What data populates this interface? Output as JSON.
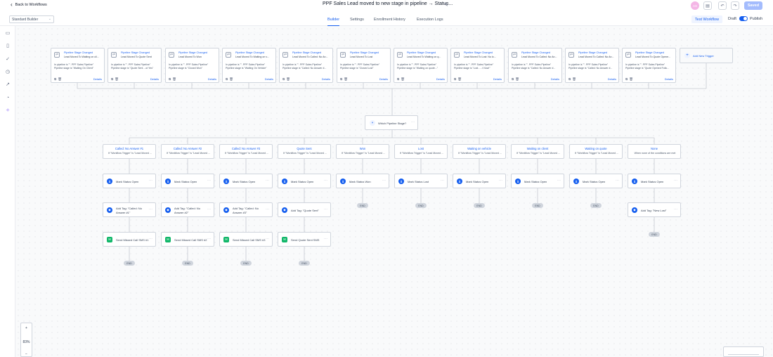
{
  "header": {
    "back_label": "Back to Workflows",
    "title": "PPF Sales Lead moved to new stage in pipeline → Status...",
    "avatar_initials": "AS",
    "save_label": "Saved"
  },
  "subbar": {
    "builder_select": "Standard Builder",
    "tabs": [
      "Builder",
      "Settings",
      "Enrollment History",
      "Execution Logs"
    ],
    "active_tab": "Builder",
    "test_workflow": "Test Workflow",
    "draft_label": "Draft",
    "publish_label": "Publish"
  },
  "triggers": [
    {
      "title": "Pipeline Stage Changed",
      "subtitle": "Lead Moved To Waiting on cli...",
      "desc1": "In pipeline is \"\". PPF Sales Pipeline\"",
      "desc2": "Pipeline stage is \"Waiting On Client\"",
      "details": "Details"
    },
    {
      "title": "Pipeline Stage Changed",
      "subtitle": "Lead Moved To Quote Sent",
      "desc1": "In pipeline is \"\". PPF Sales Pipeline\"",
      "desc2": "Pipeline stage is \"Quote Sent ...ot Yes\"",
      "details": "Details"
    },
    {
      "title": "Pipeline Stage Changed",
      "subtitle": "Lead Moved To Won",
      "desc1": "In pipeline is \"\". PPF Sales Pipeline\"",
      "desc2": "Pipeline stage is \"Closed Won\"",
      "details": "Details"
    },
    {
      "title": "Pipeline Stage Changed",
      "subtitle": "Lead Moved To Waiting on v...",
      "desc1": "In pipeline is \"\". PPF Sales Pipeline\"",
      "desc2": "Pipeline stage is \"Waiting On Vehicle\"",
      "details": "Details"
    },
    {
      "title": "Pipeline Stage Changed",
      "subtitle": "Lead Moved To Called: No An...",
      "desc1": "In pipeline is \"\". PPF Sales Pipeline\"",
      "desc2": "Pipeline stage is \"Called: No Answer #...",
      "details": "Details"
    },
    {
      "title": "Pipeline Stage Changed",
      "subtitle": "Lead Moved To Lost",
      "desc1": "In pipeline is \"\". PPF Sales Pipeline\"",
      "desc2": "Pipeline stage is \"Closed Lost\"",
      "details": "Details"
    },
    {
      "title": "Pipeline Stage Changed",
      "subtitle": "Lead Moved To Waiting on q...",
      "desc1": "In pipeline is \"\". PPF Sales Pipeline\"",
      "desc2": "Pipeline stage is \"Waiting on quote...\"",
      "details": "Details"
    },
    {
      "title": "Pipeline Stage Changed",
      "subtitle": "Lead Moved To Lost: No lo...",
      "desc1": "In pipeline is \"\". PPF Sales Pipeline\"",
      "desc2": "Pipeline stage is \"Lost - ...t Now!\"",
      "details": "Details"
    },
    {
      "title": "Pipeline Stage Changed",
      "subtitle": "Lead Moved To Called: No An...",
      "desc1": "In pipeline is \"\". PPF Sales Pipeline\"",
      "desc2": "Pipeline stage is \"Called: No Answer #...",
      "details": "Details"
    },
    {
      "title": "Pipeline Stage Changed",
      "subtitle": "Lead Moved To Called: No An...",
      "desc1": "In pipeline is \"\". PPF Sales Pipeline\"",
      "desc2": "Pipeline stage is \"Called: No Answer #...",
      "details": "Details"
    },
    {
      "title": "Pipeline Stage Changed",
      "subtitle": "Lead Moved To Quote Opene...",
      "desc1": "In pipeline is \"\". PPF Sales Pipeline\"",
      "desc2": "Pipeline stage is \"Quote Opened Follo...",
      "details": "Details"
    }
  ],
  "add_trigger_label": "Add New Trigger",
  "ifelse_label": "Which Pipeline Stage?",
  "branches": [
    {
      "name": "Called: No Answer #1",
      "cond": "If \"Workflow Trigger\" is \"Lead Moved ..."
    },
    {
      "name": "Called: No Answer #2",
      "cond": "If \"Workflow Trigger\" is \"Lead Moved ..."
    },
    {
      "name": "Called: No Answer #3",
      "cond": "If \"Workflow Trigger\" is \"Lead Moved ..."
    },
    {
      "name": "Quote Sent",
      "cond": "If \"Workflow Trigger\" is \"Lead Moved ..."
    },
    {
      "name": "Won",
      "cond": "If \"Workflow Trigger\" is \"Lead Moved ..."
    },
    {
      "name": "Lost",
      "cond": "If \"Workflow Trigger\" is \"Lead Moved ..."
    },
    {
      "name": "Waiting on vehicle",
      "cond": "If \"Workflow Trigger\" is \"Lead Moved ..."
    },
    {
      "name": "Waiting on client",
      "cond": "If \"Workflow Trigger\" is \"Lead Moved ..."
    },
    {
      "name": "Waiting on quote",
      "cond": "If \"Workflow Trigger\" is \"Lead Moved ..."
    },
    {
      "name": "None",
      "cond": "When none of the conditions are met"
    }
  ],
  "status_actions": [
    "Mark Status Open",
    "Mark Status Open",
    "Mark Status Open",
    "Mark Status Open",
    "Mark Status Won",
    "Mark Status Lost",
    "Mark Status Open",
    "Mark Status Open",
    "Mark Status Open",
    "Mark Status Open"
  ],
  "tag_actions": [
    "Add Tag: \"Called: No Answer #1\"",
    "Add Tag: \"Called: No Answer #2\"",
    "Add Tag: \"Called: No Answer #3\"",
    "Add Tag: \"Quote Sent\"",
    "Add Tag: \"New Lost\""
  ],
  "sms_actions": [
    "Send Missed Call SMS #1",
    "Send Missed Call SMS #2",
    "Send Missed Call SMS #3",
    "Send Quote Sent SMS"
  ],
  "end_label": "END",
  "zoom": {
    "plus": "+",
    "level": "83%",
    "minus": "−"
  },
  "colors": {
    "accent": "#155eef",
    "wire": "#c4c9d1",
    "status_icon": "#155eef",
    "tag_icon": "#155eef",
    "sms_icon": "#12b76a"
  }
}
